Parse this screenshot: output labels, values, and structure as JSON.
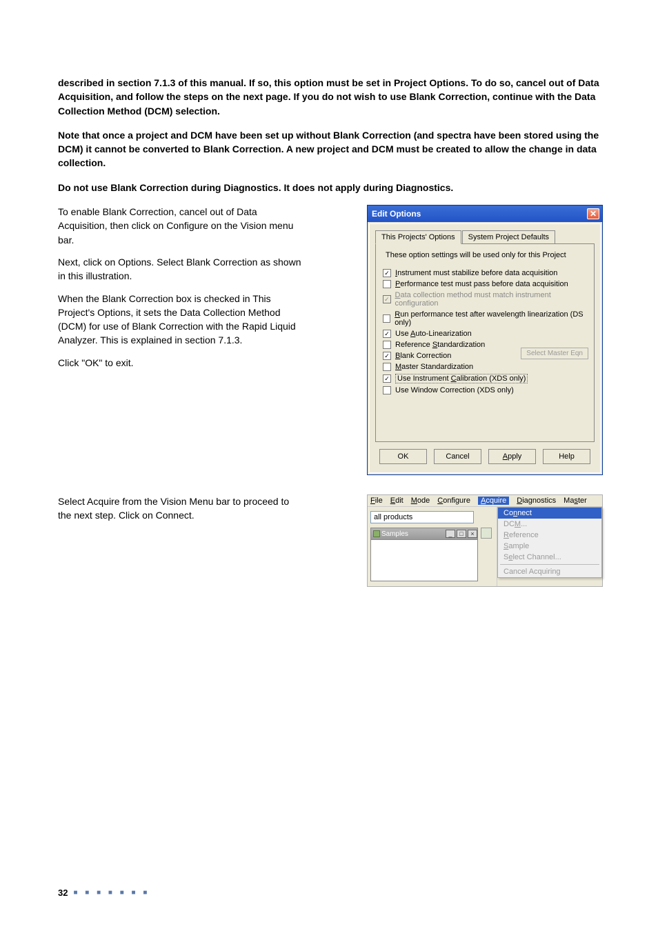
{
  "para1": "described in section 7.1.3 of this manual. If so, this option must be set in Project Options. To do so, cancel out of Data Acquisition, and follow the steps on the next page. If you do not wish to use Blank Correction, continue with the Data Collection Method (DCM) selection.",
  "para2": "Note that once a project and DCM have been set up without Blank Correction (and spectra have been stored using the DCM) it cannot be converted to Blank Correction. A new project and DCM must be created to allow the change in data collection.",
  "para3": "Do not use Blank Correction during Diagnostics. It does not apply during Diagnostics.",
  "left1": "To enable Blank Correction, cancel out of Data Acquisition, then click on Configure on the Vision menu bar.",
  "left2": "Next, click on Options. Select Blank Correction as shown in this illustration.",
  "left3": "When the Blank Correction box is checked in This Project's Options, it sets the Data Collection Method (DCM) for use of Blank Correction with the Rapid Liquid Analyzer. This is explained in section 7.1.3.",
  "left4": "Click \"OK\" to exit.",
  "left5": "Select Acquire from the Vision Menu bar to proceed to the next step. Click on Connect.",
  "dialog": {
    "title": "Edit Options",
    "tab1": "This Projects' Options",
    "tab2": "System Project Defaults",
    "hint": "These option settings will be used only for this Project",
    "mastereqn": "Select Master Eqn",
    "options": [
      {
        "checked": true,
        "disabled": false,
        "mn": "I",
        "rest": "nstrument must stabilize before data acquisition"
      },
      {
        "checked": false,
        "disabled": false,
        "mn": "P",
        "rest": "erformance test must pass before data acquisition"
      },
      {
        "checked": true,
        "disabled": true,
        "mn": "D",
        "rest": "ata collection method must match instrument configuration"
      },
      {
        "checked": false,
        "disabled": false,
        "mn": "R",
        "rest": "un performance test after wavelength linearization (DS only)"
      },
      {
        "checked": true,
        "disabled": false,
        "mn": "A",
        "pre": "Use ",
        "rest": "uto-Linearization"
      },
      {
        "checked": false,
        "disabled": false,
        "mn": "S",
        "pre": "Reference ",
        "rest": "tandardization"
      },
      {
        "checked": true,
        "disabled": false,
        "mn": "B",
        "rest": "lank Correction"
      },
      {
        "checked": false,
        "disabled": false,
        "mn": "M",
        "rest": "aster Standardization"
      },
      {
        "checked": true,
        "disabled": false,
        "mn": "C",
        "pre": "Use Instrument ",
        "rest": "alibration (XDS only)",
        "dotted": true
      },
      {
        "checked": false,
        "disabled": false,
        "mn": "",
        "rest": "Use Window Correction (XDS only)"
      }
    ],
    "buttons": {
      "ok": "OK",
      "cancel": "Cancel",
      "apply": "Apply",
      "help": "Help"
    }
  },
  "menushot": {
    "menubar": [
      "File",
      "Edit",
      "Mode",
      "Configure",
      "Acquire",
      "Diagnostics",
      "Master"
    ],
    "active": 4,
    "prodbox": "all products",
    "samples_title": "Samples",
    "dropdown": [
      {
        "label": "Connect",
        "state": "sel",
        "mn": 2
      },
      {
        "label": "DCM...",
        "state": "dis",
        "mn": 2
      },
      {
        "label": "Reference",
        "state": "dis",
        "mn": 0
      },
      {
        "label": "Sample",
        "state": "dis",
        "mn": 0
      },
      {
        "label": "Select Channel...",
        "state": "dis",
        "mn": 1
      },
      {
        "label": "---"
      },
      {
        "label": "Cancel Acquiring",
        "state": "dis",
        "mn": -1
      }
    ]
  },
  "pagenum": "32",
  "dots": "■ ■ ■ ■ ■ ■ ■"
}
